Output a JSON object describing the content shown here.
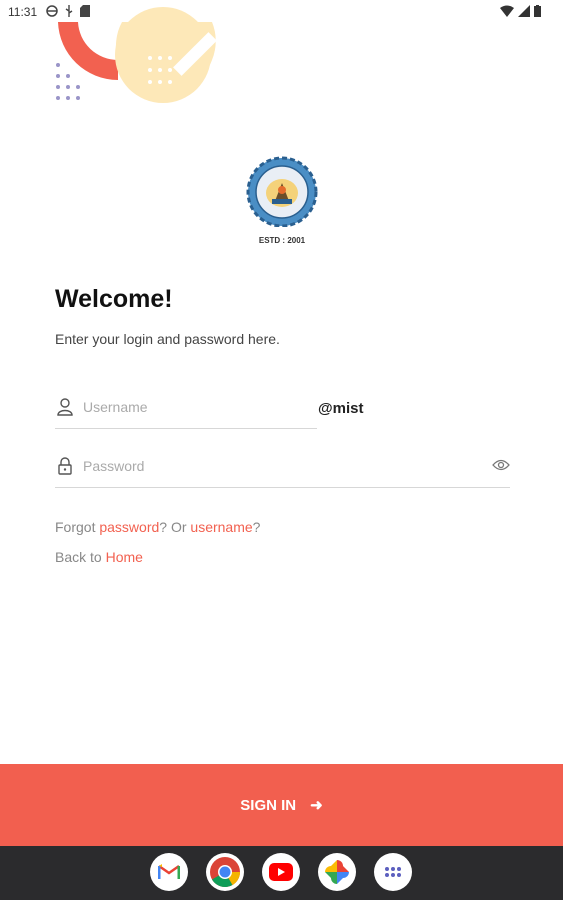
{
  "status_bar": {
    "time": "11:31",
    "icons_left": [
      "vpn-icon",
      "usb-icon",
      "sd-card-icon"
    ],
    "icons_right": [
      "wifi-icon",
      "signal-icon",
      "battery-icon"
    ]
  },
  "logo": {
    "caption": "ESTD : 2001"
  },
  "login": {
    "title": "Welcome!",
    "subtitle": "Enter your login and password here.",
    "username_placeholder": "Username",
    "username_value": "",
    "domain_suffix": "@mist",
    "password_placeholder": "Password",
    "password_value": ""
  },
  "links": {
    "forgot_prefix": "Forgot ",
    "password_link": "password",
    "forgot_middle": "? Or ",
    "username_link": "username",
    "forgot_suffix": "?",
    "back_prefix": "Back to ",
    "home_link": "Home"
  },
  "signin": {
    "label": "SIGN IN",
    "arrow": "➜"
  },
  "dock": {
    "apps": [
      "gmail-icon",
      "chrome-icon",
      "youtube-icon",
      "photos-icon",
      "app-drawer-icon"
    ]
  },
  "colors": {
    "accent": "#f25f4f",
    "link": "#f26150",
    "deco_yellow": "#fde8b8",
    "nav_bg": "#2b2b2d"
  }
}
